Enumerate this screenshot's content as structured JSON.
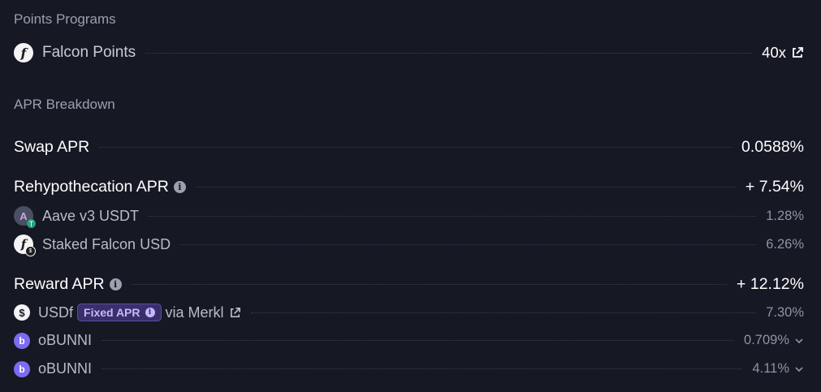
{
  "points": {
    "title": "Points Programs",
    "item": {
      "label": "Falcon Points",
      "value": "40x"
    }
  },
  "apr": {
    "title": "APR Breakdown",
    "swap": {
      "label": "Swap APR",
      "value": "0.0588%"
    },
    "rehyp": {
      "label": "Rehypothecation APR",
      "value": "+ 7.54%",
      "items": [
        {
          "label": "Aave v3 USDT",
          "value": "1.28%"
        },
        {
          "label": "Staked Falcon USD",
          "value": "6.26%"
        }
      ]
    },
    "reward": {
      "label": "Reward APR",
      "value": "+ 12.12%",
      "usdf": {
        "label": "USDf",
        "badge": "Fixed APR",
        "via": "via Merkl",
        "value": "7.30%"
      },
      "obunni": [
        {
          "label": "oBUNNI",
          "value": "0.709%"
        },
        {
          "label": "oBUNNI",
          "value": "4.11%"
        }
      ]
    }
  },
  "colors": {
    "bg": "#161824",
    "accent_badge": "#3a2f6b",
    "bunni_purple": "#7b6cf0"
  }
}
